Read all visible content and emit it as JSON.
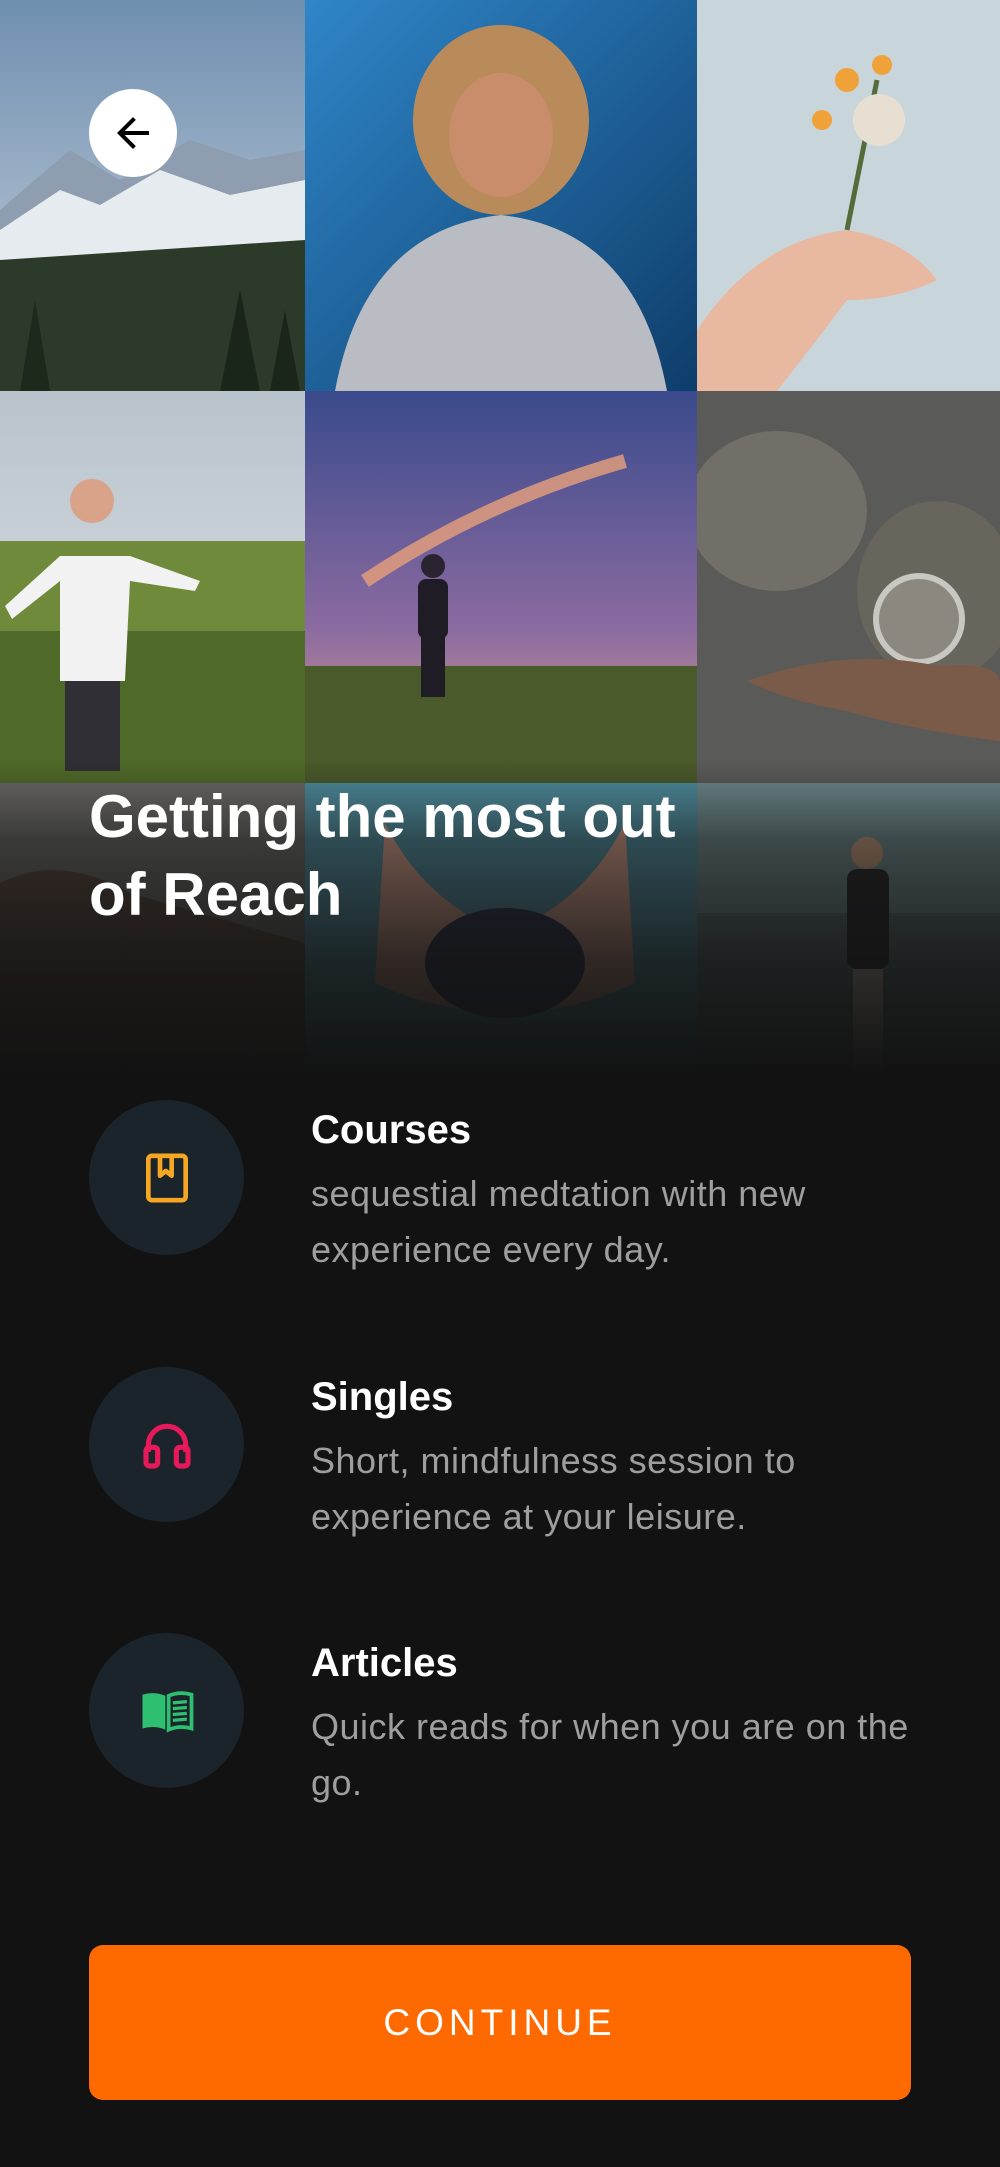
{
  "header": {
    "back_icon": "arrow-left-icon",
    "title": "Getting the most out\nof Reach"
  },
  "gallery": [
    {
      "name": "mountains-photo"
    },
    {
      "name": "laughing-woman-photo"
    },
    {
      "name": "hand-flower-photo"
    },
    {
      "name": "woman-field-photo"
    },
    {
      "name": "man-sunset-field-photo"
    },
    {
      "name": "crystal-ball-photo"
    },
    {
      "name": "rocks-photo"
    },
    {
      "name": "berries-hands-photo"
    },
    {
      "name": "woman-beach-photo"
    }
  ],
  "features": [
    {
      "icon": "bookmark-book-icon",
      "icon_color": "#f5a623",
      "title": "Courses",
      "description": "sequestial medtation with new experience every day."
    },
    {
      "icon": "headphones-icon",
      "icon_color": "#e8195a",
      "title": "Singles",
      "description": "Short, mindfulness session to experience at your leisure."
    },
    {
      "icon": "open-book-icon",
      "icon_color": "#2fbf71",
      "title": "Articles",
      "description": "Quick reads for when you are on the go."
    }
  ],
  "continue_button": {
    "label": "CONTINUE",
    "color": "#ff6a00"
  }
}
